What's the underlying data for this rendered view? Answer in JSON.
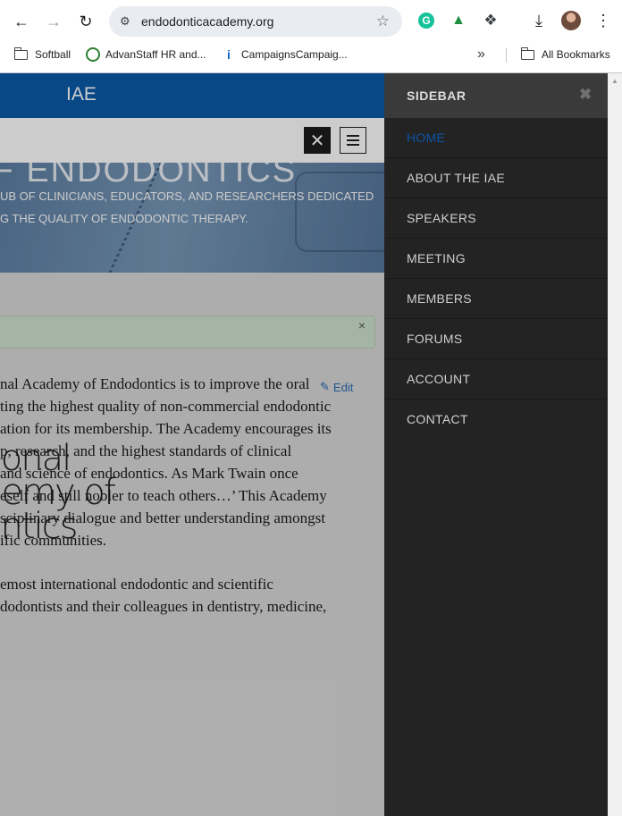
{
  "browser": {
    "url": "endodonticacademy.org",
    "bookmarks": [
      {
        "label": "Softball",
        "icon": "folder-icon"
      },
      {
        "label": "AdvanStaff HR and...",
        "icon": "advanstaff-icon"
      },
      {
        "label": "CampaignsCampaig...",
        "icon": "campaigns-icon"
      }
    ],
    "all_bookmarks": "All Bookmarks"
  },
  "site": {
    "brand": "IAE",
    "hero_title": "OF ENDODONTICS",
    "hero_sub_1": "UB OF CLINICIANS, EDUCATORS, AND RESEARCHERS DEDICATED",
    "hero_sub_2": "G THE QUALITY OF ENDODONTIC THERAPY.",
    "alert_close": "×",
    "edit_label": "Edit",
    "logo_lines": [
      "tional",
      "demy of",
      "ontics"
    ],
    "para1": [
      "nal Academy of Endodontics is to improve the oral",
      "ting the highest quality of non-commercial endodontic",
      "ation for its membership. The Academy encourages its",
      "p, research, and the highest standards of clinical",
      "and science of endodontics. As Mark Twain once",
      "eself and still nobler to teach others…’  This Academy",
      "sciplinary dialogue and better understanding amongst",
      "ific communities."
    ],
    "para2": [
      "emost international endodontic and scientific",
      "dodontists and their colleagues in dentistry, medicine,"
    ]
  },
  "sidebar": {
    "title": "SIDEBAR",
    "close": "✖",
    "items": [
      "HOME",
      "ABOUT THE IAE",
      "SPEAKERS",
      "MEETING",
      "MEMBERS",
      "FORUMS",
      "ACCOUNT",
      "CONTACT"
    ],
    "active_index": 0,
    "active_color": "#0d55a8"
  }
}
